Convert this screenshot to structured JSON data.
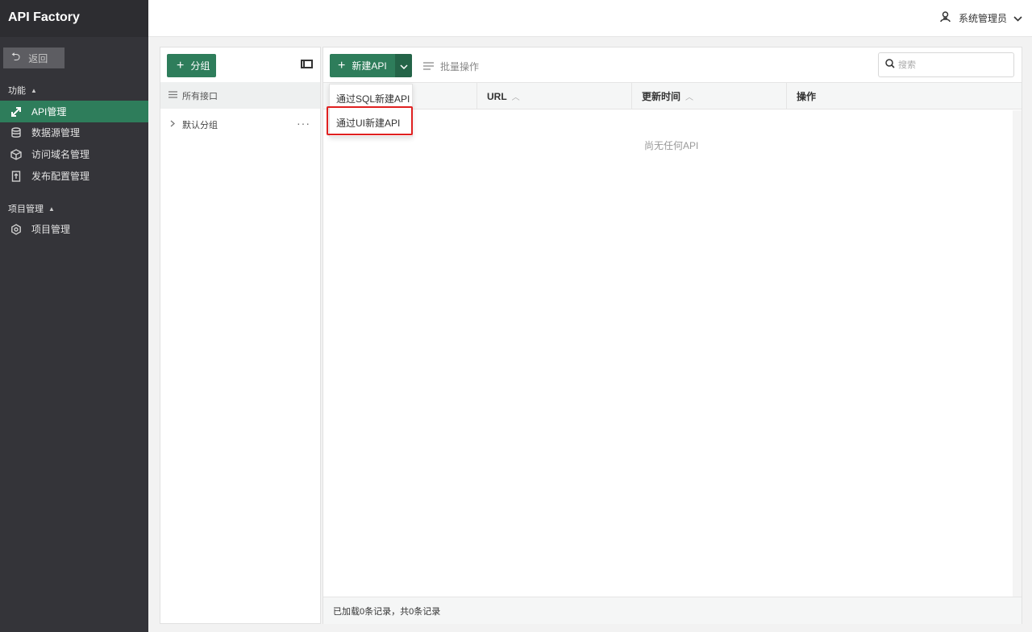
{
  "app": {
    "title": "API Factory"
  },
  "sidebar": {
    "back_label": "返回",
    "sections": [
      {
        "title": "功能"
      },
      {
        "title": "项目管理"
      }
    ],
    "items": [
      {
        "label": "API管理",
        "icon": "api-arrows-icon",
        "active": true
      },
      {
        "label": "数据源管理",
        "icon": "database-icon"
      },
      {
        "label": "访问域名管理",
        "icon": "cube-icon"
      },
      {
        "label": "发布配置管理",
        "icon": "release-config-icon"
      },
      {
        "label": "项目管理",
        "icon": "gear-icon"
      }
    ]
  },
  "header": {
    "user_label": "系统管理员"
  },
  "groups": {
    "add_label": "分组",
    "all_label": "所有接口",
    "default_group": "默认分组"
  },
  "toolbar": {
    "new_api_label": "新建API",
    "batch_label": "批量操作",
    "search_placeholder": "搜索"
  },
  "dropdown": {
    "items": [
      "通过SQL新建API",
      "通过UI新建API"
    ]
  },
  "table": {
    "columns": [
      "URL",
      "更新时间",
      "操作"
    ],
    "empty_text": "尚无任何API"
  },
  "footer": {
    "status": "已加载0条记录，共0条记录"
  },
  "colors": {
    "primary": "#2e7d5b",
    "sidebar_bg": "#343439",
    "highlight": "#e02020"
  }
}
